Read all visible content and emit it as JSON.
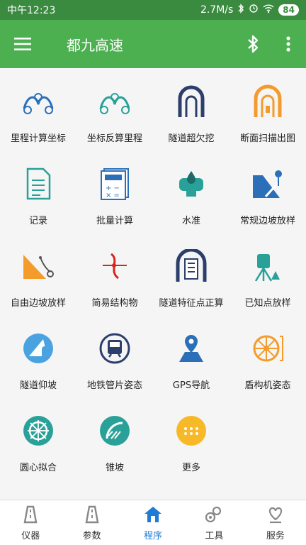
{
  "status_bar": {
    "time": "中午12:23",
    "speed": "2.7M/s",
    "battery": "84"
  },
  "app_bar": {
    "title": "都九高速"
  },
  "grid": [
    {
      "label": "里程计算坐标",
      "icon": "kxy-curve-icon"
    },
    {
      "label": "坐标反算里程",
      "icon": "xyk-curve-icon"
    },
    {
      "label": "隧道超欠挖",
      "icon": "tunnel-overbreak-icon"
    },
    {
      "label": "断面扫描出图",
      "icon": "section-scan-icon"
    },
    {
      "label": "记录",
      "icon": "document-icon"
    },
    {
      "label": "批量计算",
      "icon": "calculator-icon"
    },
    {
      "label": "水准",
      "icon": "level-icon"
    },
    {
      "label": "常规边坡放样",
      "icon": "slope-stakeout-icon"
    },
    {
      "label": "自由边坡放样",
      "icon": "free-slope-icon"
    },
    {
      "label": "简易结构物",
      "icon": "structure-icon"
    },
    {
      "label": "隧道特征点正算",
      "icon": "tunnel-feature-icon"
    },
    {
      "label": "已知点放样",
      "icon": "total-station-icon"
    },
    {
      "label": "隧道仰坡",
      "icon": "tunnel-slope-icon"
    },
    {
      "label": "地铁管片姿态",
      "icon": "metro-icon"
    },
    {
      "label": "GPS导航",
      "icon": "gps-pin-icon"
    },
    {
      "label": "盾构机姿态",
      "icon": "tbm-icon"
    },
    {
      "label": "圆心拟合",
      "icon": "circle-fit-icon"
    },
    {
      "label": "锥坡",
      "icon": "cone-slope-icon"
    },
    {
      "label": "更多",
      "icon": "more-dots-icon"
    }
  ],
  "bottom_nav": [
    {
      "label": "仪器",
      "icon": "road-icon"
    },
    {
      "label": "参数",
      "icon": "road-icon"
    },
    {
      "label": "程序",
      "icon": "home-icon"
    },
    {
      "label": "工具",
      "icon": "gears-icon"
    },
    {
      "label": "服务",
      "icon": "heart-hand-icon"
    }
  ],
  "colors": {
    "status_bar": "#3a8b40",
    "app_bar": "#4caf50",
    "active_tab": "#1e7bd6",
    "blue_icon": "#2b6fb8",
    "orange_icon": "#f39c2c",
    "teal_icon": "#2aa198"
  }
}
